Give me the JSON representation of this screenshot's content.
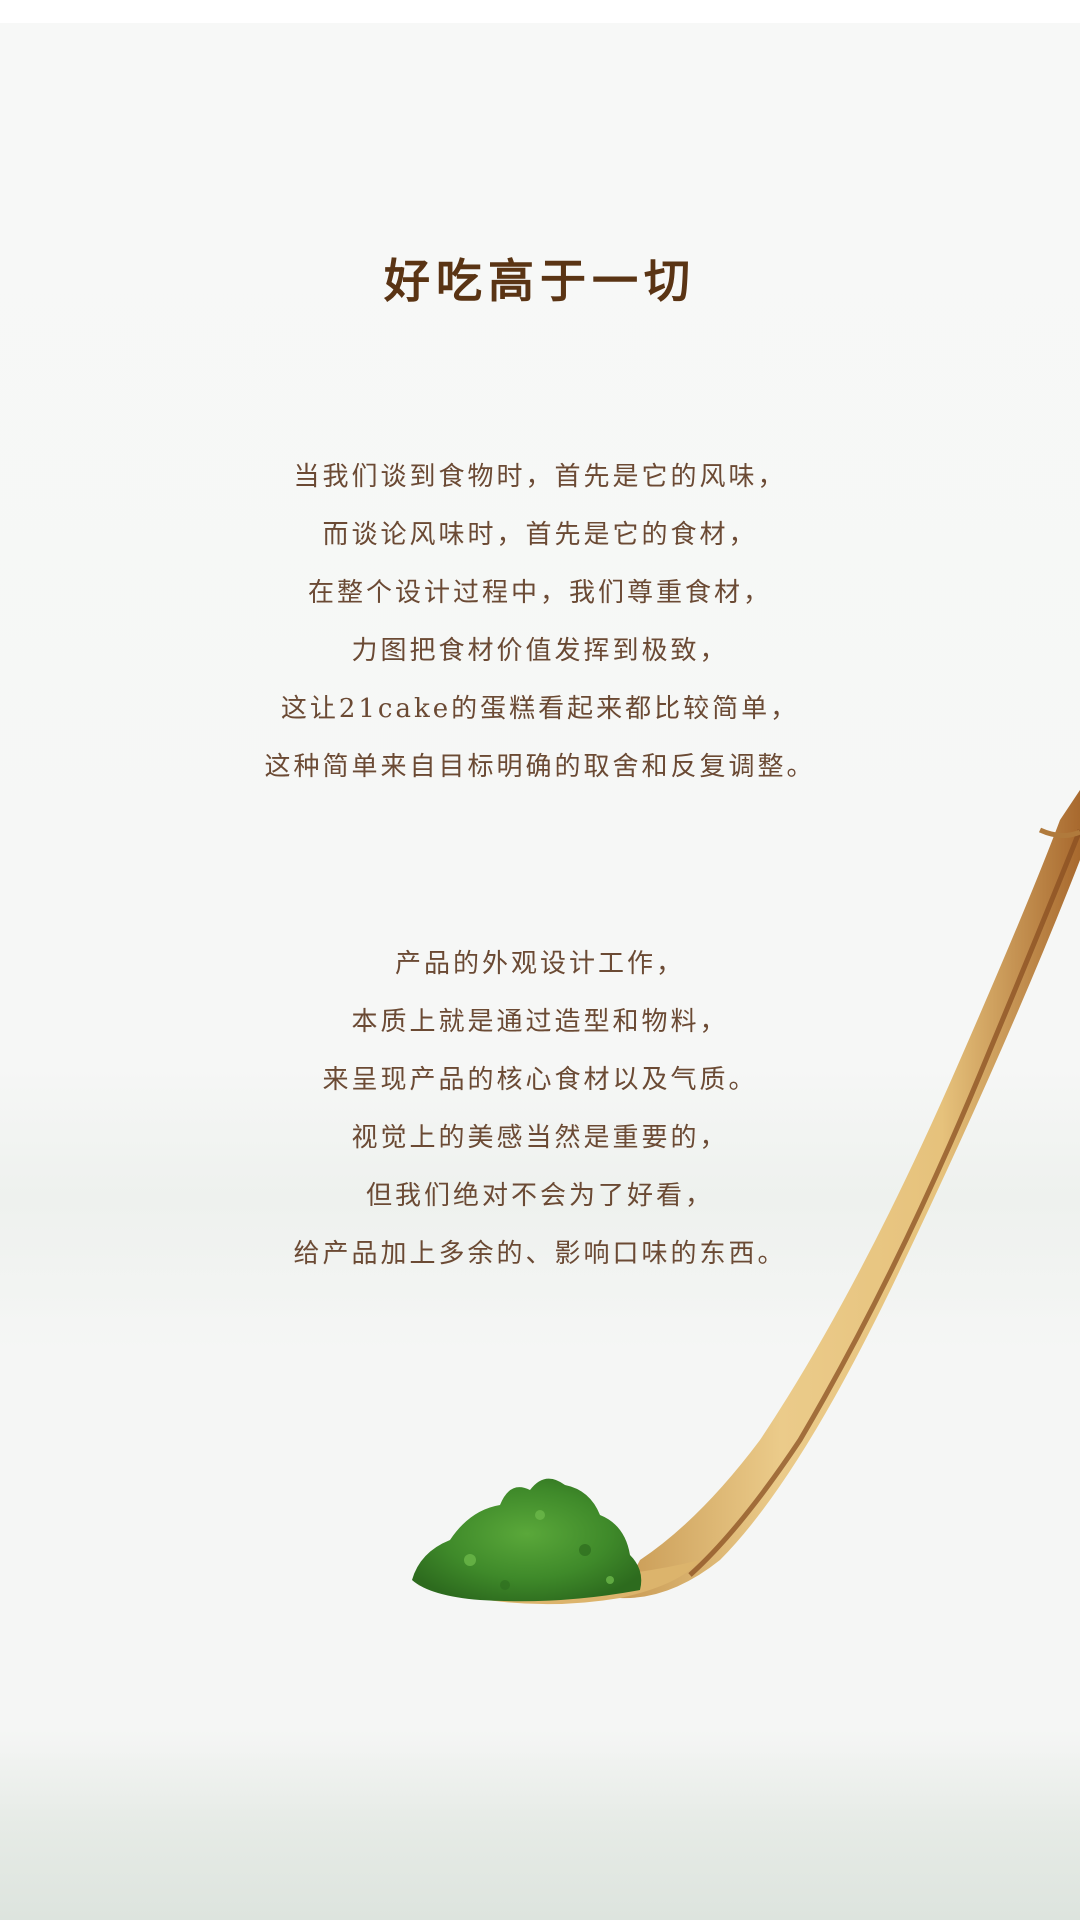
{
  "headline": "好吃高于一切",
  "paragraph_1": [
    "当我们谈到食物时，首先是它的风味，",
    "而谈论风味时，首先是它的食材，",
    "在整个设计过程中，我们尊重食材，",
    "力图把食材价值发挥到极致，",
    "这让21cake的蛋糕看起来都比较简单，",
    "这种简单来自目标明确的取舍和反复调整。"
  ],
  "paragraph_2": [
    "产品的外观设计工作，",
    "本质上就是通过造型和物料，",
    "来呈现产品的核心食材以及气质。",
    "视觉上的美感当然是重要的，",
    "但我们绝对不会为了好看，",
    "给产品加上多余的、影响口味的东西。"
  ],
  "colors": {
    "headline": "#5a3414",
    "body_text": "#6b4a34",
    "bamboo": "#e2bf7a",
    "matcha": "#3f8a2a"
  },
  "illustration": {
    "icon": "bamboo-scoop-with-matcha-powder"
  }
}
